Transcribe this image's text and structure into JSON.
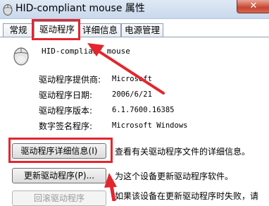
{
  "window": {
    "title": "HID-compliant mouse 属性",
    "close_label": "✕"
  },
  "tabs": [
    {
      "label": "常规"
    },
    {
      "label": "驱动程序"
    },
    {
      "label": "详细信息"
    },
    {
      "label": "电源管理"
    }
  ],
  "device": {
    "name": "HID-compliant mouse",
    "icon": "mouse-icon"
  },
  "properties": [
    {
      "label": "驱动程序提供商:",
      "value": "Microsoft"
    },
    {
      "label": "驱动程序日期:",
      "value": "2006/6/21"
    },
    {
      "label": "驱动程序版本:",
      "value": "6.1.7600.16385"
    },
    {
      "label": "数字签名程序:",
      "value": "Microsoft Windows"
    }
  ],
  "buttons": {
    "details": {
      "label": "驱动程序详细信息(I)",
      "desc": "查看有关驱动程序文件的详细信息。"
    },
    "update": {
      "label": "更新驱动程序(P)...",
      "desc": "为这个设备更新驱动程序软件。"
    },
    "rollback": {
      "label": "回滚驱动程序",
      "desc": "如果该设备在更新驱动程序时失败，请"
    }
  },
  "colors": {
    "highlight": "#e3262e"
  }
}
